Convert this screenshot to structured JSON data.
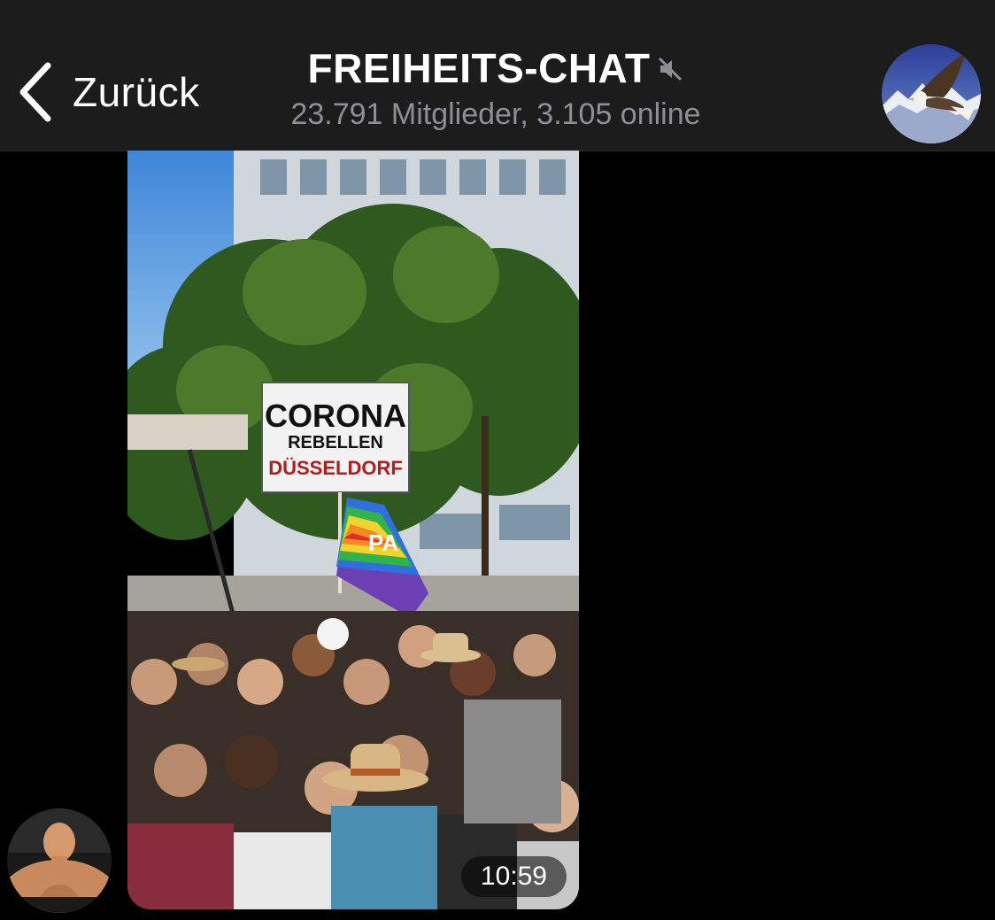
{
  "header": {
    "back_label": "Zurück",
    "title": "FREIHEITS-CHAT",
    "subtitle": "23.791 Mitglieder, 3.105 online",
    "muted": true
  },
  "message": {
    "time": "10:59",
    "sign": {
      "line1": "CORONA",
      "line2": "REBELLEN",
      "line3": "DÜSSELDORF"
    },
    "flag_text": "PA"
  },
  "colors": {
    "header_bg": "#1c1c1d",
    "background": "#000000",
    "subtitle": "#8e8e93"
  },
  "icons": [
    "chevron-left-icon",
    "mute-icon"
  ]
}
